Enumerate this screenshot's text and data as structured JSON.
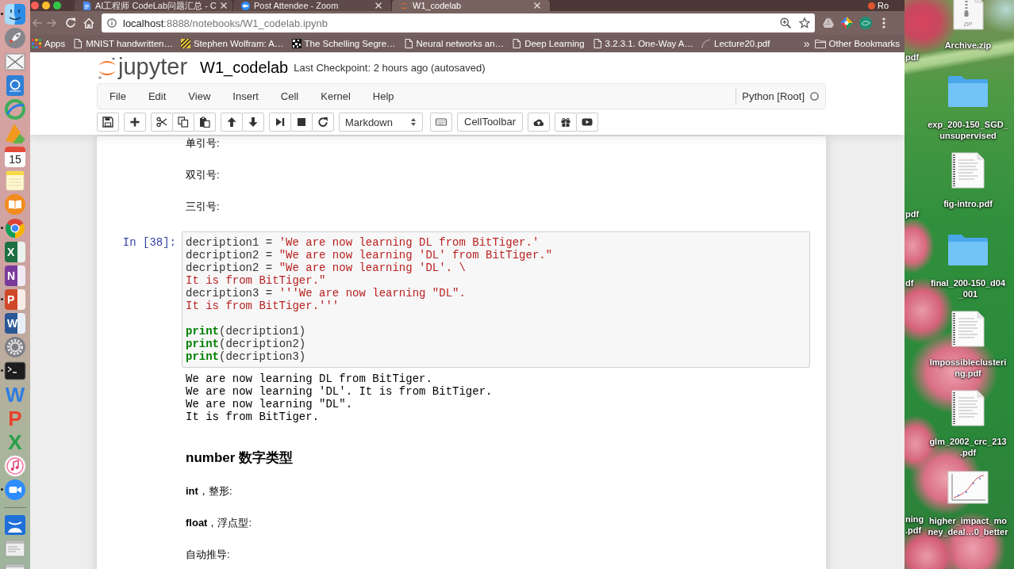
{
  "dock": {
    "apps": [
      {
        "kind": "files",
        "running": true
      },
      {
        "kind": "rocket",
        "running": false
      },
      {
        "kind": "viewer",
        "running": false
      },
      {
        "kind": "contacts",
        "running": false
      },
      {
        "kind": "ring",
        "running": false
      },
      {
        "kind": "sketch",
        "running": false
      },
      {
        "kind": "calendar",
        "text": "15",
        "running": false
      },
      {
        "kind": "notes",
        "running": false
      },
      {
        "kind": "books",
        "running": false
      },
      {
        "kind": "web",
        "running": true
      },
      {
        "kind": "sheet",
        "text": "X",
        "running": false
      },
      {
        "kind": "notebook",
        "text": "N",
        "running": false
      },
      {
        "kind": "slides",
        "text": "P",
        "running": true
      },
      {
        "kind": "doc",
        "text": "W",
        "running": false
      },
      {
        "kind": "settings",
        "running": false
      },
      {
        "kind": "terminal",
        "running": true
      },
      {
        "kind": "letter",
        "text": "W",
        "color": "#2f7de1",
        "running": false
      },
      {
        "kind": "letter",
        "text": "P",
        "color": "#e8412c",
        "running": false
      },
      {
        "kind": "letter",
        "text": "X",
        "color": "#27a048",
        "running": false
      },
      {
        "kind": "music",
        "running": false
      },
      {
        "kind": "video",
        "running": true
      }
    ],
    "stacks": [
      {
        "kind": "cloud"
      },
      {
        "kind": "window"
      },
      {
        "kind": "window"
      }
    ]
  },
  "browser": {
    "tabs": [
      {
        "kind": "doc",
        "title": "AI工程师 CodeLab问题汇总 - C",
        "selected": false
      },
      {
        "kind": "meeting",
        "title": "Post Attendee - Zoom",
        "selected": false
      },
      {
        "kind": "notebook",
        "title": "W1_codelab",
        "selected": true
      }
    ],
    "profile_name": "Ro",
    "url": {
      "host": "localhost",
      "rest": ":8888/notebooks/W1_codelab.ipynb"
    },
    "bookmarks": [
      {
        "kind": "apps",
        "label": "Apps"
      },
      {
        "kind": "page",
        "label": "MNIST handwritten…"
      },
      {
        "kind": "striped",
        "label": "Stephen Wolfram: A…"
      },
      {
        "kind": "pixel",
        "label": "The Schelling Segre…"
      },
      {
        "kind": "page",
        "label": "Neural networks an…"
      },
      {
        "kind": "page",
        "label": "Deep Learning"
      },
      {
        "kind": "page",
        "label": "3.2.3.1. One-Way A…"
      },
      {
        "kind": "dotted",
        "label": "Lecture20.pdf"
      }
    ],
    "more_bookmarks": "»",
    "other_bookmarks": "Other Bookmarks",
    "page": {
      "logo_text": "jupyter",
      "notebook_name": "W1_codelab",
      "checkpoint": "Last Checkpoint: 2 hours ago (autosaved)",
      "menu": [
        "File",
        "Edit",
        "View",
        "Insert",
        "Cell",
        "Kernel",
        "Help"
      ],
      "kernel": {
        "name": "Python [Root]",
        "busy": false
      },
      "toolbar": {
        "cell_type": "Markdown",
        "cell_toolbar": "CellToolbar"
      },
      "cells": [
        {
          "kind": "markdown",
          "text": "单引号:"
        },
        {
          "kind": "markdown",
          "text": "双引号:"
        },
        {
          "kind": "markdown",
          "text": "三引号:"
        },
        {
          "kind": "code",
          "prompt": "In [38]:",
          "code": [
            [
              [
                {
                  "kind": "plain",
                  "text": "decription1 = "
                },
                {
                  "kind": "string",
                  "text": "'We are now learning DL from BitTiger.'"
                }
              ],
              [
                {
                  "kind": "plain",
                  "text": "decription2 = "
                },
                {
                  "kind": "string",
                  "text": "\"We are now learning 'DL' from BitTiger.\""
                }
              ],
              [
                {
                  "kind": "plain",
                  "text": "decription2 = "
                },
                {
                  "kind": "string",
                  "text": "\"We are now learning 'DL'. \\"
                }
              ],
              [
                {
                  "kind": "string",
                  "text": "It is from BitTiger.\""
                }
              ],
              [
                {
                  "kind": "plain",
                  "text": "decription3 = "
                },
                {
                  "kind": "string",
                  "text": "'''We are now learning \"DL\"."
                }
              ],
              [
                {
                  "kind": "string",
                  "text": "It is from BitTiger.'''"
                }
              ]
            ],
            [
              [
                {
                  "kind": "builtin",
                  "text": "print"
                },
                {
                  "kind": "plain",
                  "text": "(decription1)"
                }
              ],
              [
                {
                  "kind": "builtin",
                  "text": "print"
                },
                {
                  "kind": "plain",
                  "text": "(decription2)"
                }
              ],
              [
                {
                  "kind": "builtin",
                  "text": "print"
                },
                {
                  "kind": "plain",
                  "text": "(decription3)"
                }
              ]
            ]
          ],
          "output": [
            "We are now learning DL from BitTiger.",
            "We are now learning 'DL'. It is from BitTiger.",
            "We are now learning \"DL\".",
            "It is from BitTiger."
          ]
        },
        {
          "kind": "heading",
          "text": "number 数字类型"
        },
        {
          "kind": "markdown",
          "text": "**int**，整形:"
        },
        {
          "kind": "markdown",
          "text": "**float**，浮点型:"
        },
        {
          "kind": "markdown",
          "text": "自动推导:"
        }
      ]
    }
  },
  "desktop": {
    "icons": [
      {
        "kind": "archive",
        "badge": "ZIP",
        "lines": [
          "Archive.zip"
        ]
      },
      {
        "kind": "folder",
        "lines": [
          "exp_200-150_SGD_",
          "unsupervised"
        ]
      },
      {
        "kind": "document",
        "lines": [
          "fig-intro.pdf"
        ]
      },
      {
        "kind": "folder",
        "lines": [
          "final_200-150_d04",
          "_001"
        ]
      },
      {
        "kind": "document",
        "lines": [
          "Impossibleclusteri",
          "ng.pdf"
        ]
      },
      {
        "kind": "document",
        "lines": [
          "glm_2002_crc_213",
          ".pdf"
        ]
      },
      {
        "kind": "chart",
        "lines": [
          "higher_impact_mo",
          "ney_deal…0_better"
        ]
      }
    ],
    "partly_hidden_labels": [
      "pdf",
      "pdf",
      "df",
      "ning",
      ".pdf"
    ]
  }
}
